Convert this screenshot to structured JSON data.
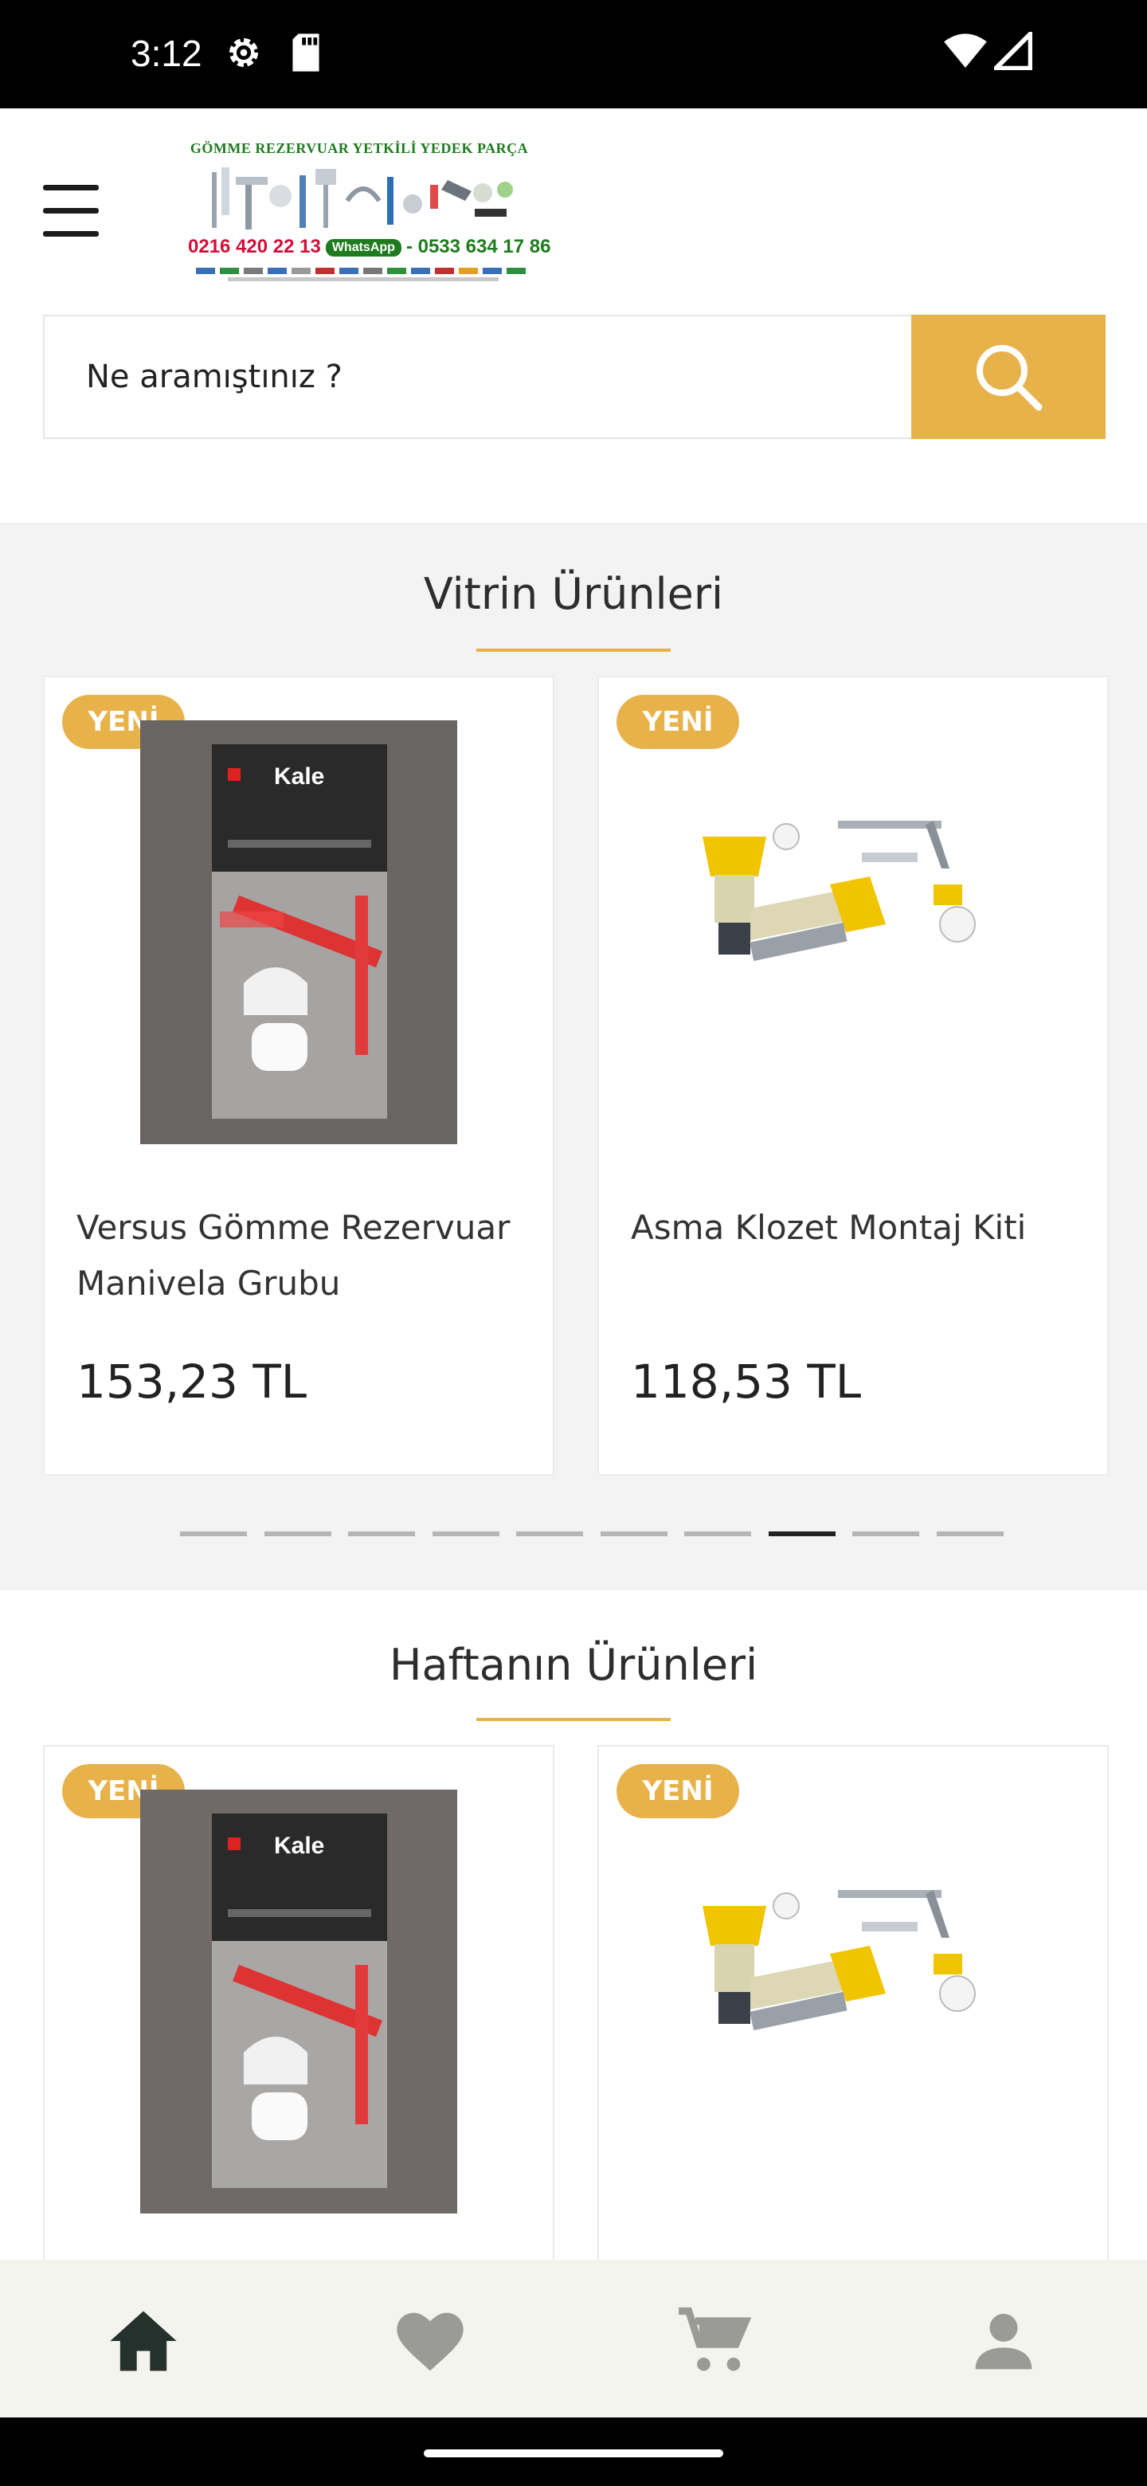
{
  "status_bar": {
    "time": "3:12",
    "icons": [
      "settings-gear-icon",
      "sd-card-icon",
      "wifi-icon",
      "signal-icon"
    ]
  },
  "header": {
    "menu_icon": "hamburger-menu-icon",
    "logo": {
      "title": "GÖMME REZERVUAR YETKİLİ YEDEK PARÇA",
      "phone": "0216 420 22 13",
      "whatsapp_label": "WhatsApp",
      "mobile": "- 0533 634 17 86"
    }
  },
  "search": {
    "placeholder": "Ne aramıştınız ?",
    "value": "",
    "icon": "search-icon",
    "accent": "#e8b24a"
  },
  "showcase": {
    "title": "Vitrin Ürünleri",
    "products": [
      {
        "badge": "YENİ",
        "name": "Versus Gömme Rezervuar Manivela Grubu",
        "price": "153,23 TL",
        "image": "kale-lever-pack"
      },
      {
        "badge": "YENİ",
        "name": "Asma Klozet Montaj Kiti",
        "price": "118,53 TL",
        "image": "toilet-mounting-kit"
      }
    ],
    "carousel": {
      "total_pages": 10,
      "active_page": 8
    }
  },
  "weekly": {
    "title": "Haftanın Ürünleri",
    "products": [
      {
        "badge": "YENİ",
        "image": "kale-lever-pack"
      },
      {
        "badge": "YENİ",
        "image": "toilet-mounting-kit"
      }
    ]
  },
  "bottom_nav": {
    "items": [
      "home-icon",
      "favorites-heart-icon",
      "cart-icon",
      "account-icon"
    ],
    "active": "home-icon"
  },
  "colors": {
    "accent": "#e8b24a",
    "section_bg": "#f3f3f3",
    "nav_bg": "#f4f4ee"
  }
}
